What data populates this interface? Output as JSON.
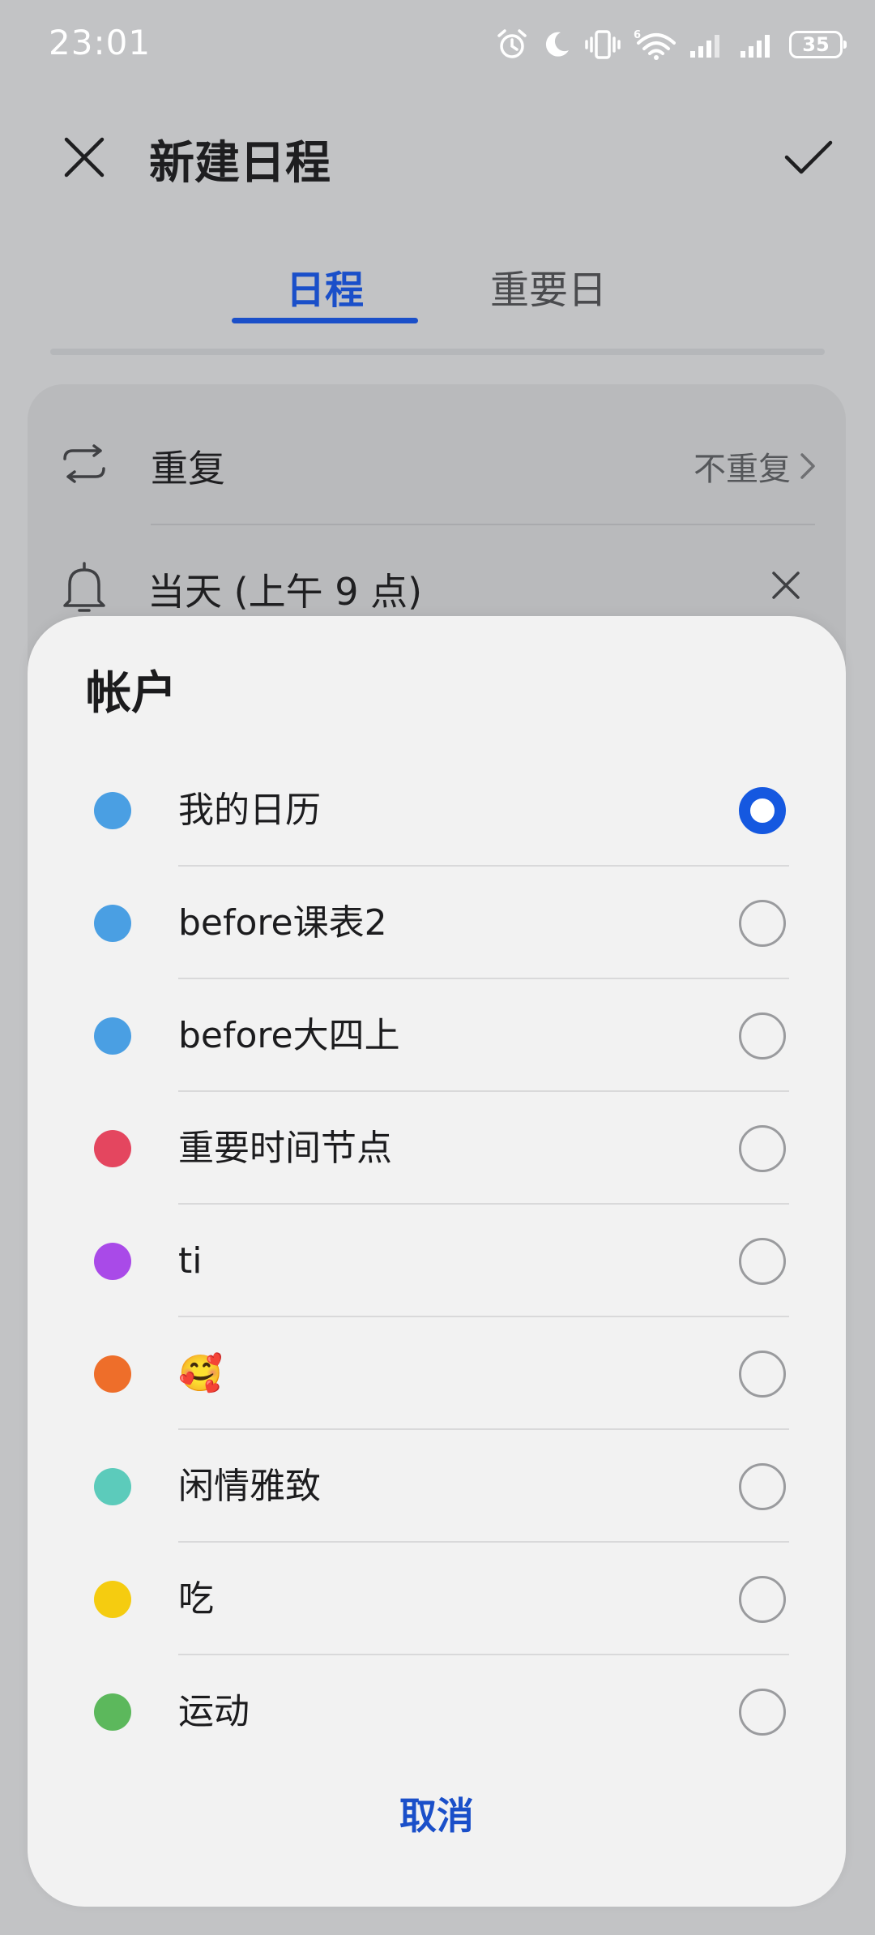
{
  "status_bar": {
    "time": "23:01",
    "battery": "35",
    "icons": [
      "alarm-icon",
      "moon-icon",
      "vibrate-icon",
      "wifi-6-icon",
      "signal-icon",
      "signal-icon",
      "battery-icon"
    ]
  },
  "app_bar": {
    "title": "新建日程",
    "close_icon": "close-icon",
    "confirm_icon": "check-icon"
  },
  "tabs": {
    "items": [
      {
        "label": "日程",
        "active": true
      },
      {
        "label": "重要日",
        "active": false
      }
    ],
    "accent_color": "#1a4fc9"
  },
  "event_form": {
    "repeat": {
      "icon": "repeat-icon",
      "label": "重复",
      "value": "不重复"
    },
    "reminder": {
      "icon": "bell-icon",
      "label": "当天 (上午 9 点)"
    }
  },
  "account_sheet": {
    "title": "帐户",
    "cancel_label": "取消",
    "accounts": [
      {
        "name": "我的日历",
        "color": "#4a9fe3",
        "selected": true
      },
      {
        "name": "before课表2",
        "color": "#4a9fe3",
        "selected": false
      },
      {
        "name": "before大四上",
        "color": "#4a9fe3",
        "selected": false
      },
      {
        "name": "重要时间节点",
        "color": "#e4465f",
        "selected": false
      },
      {
        "name": "ti",
        "color": "#a94ae8",
        "selected": false
      },
      {
        "name": "🥰",
        "color": "#ee6e2a",
        "selected": false
      },
      {
        "name": "闲情雅致",
        "color": "#5ccbbb",
        "selected": false
      },
      {
        "name": "吃",
        "color": "#f5cc10",
        "selected": false
      },
      {
        "name": "运动",
        "color": "#5cb85c",
        "selected": false
      }
    ],
    "selected_color": "#1558e0"
  }
}
